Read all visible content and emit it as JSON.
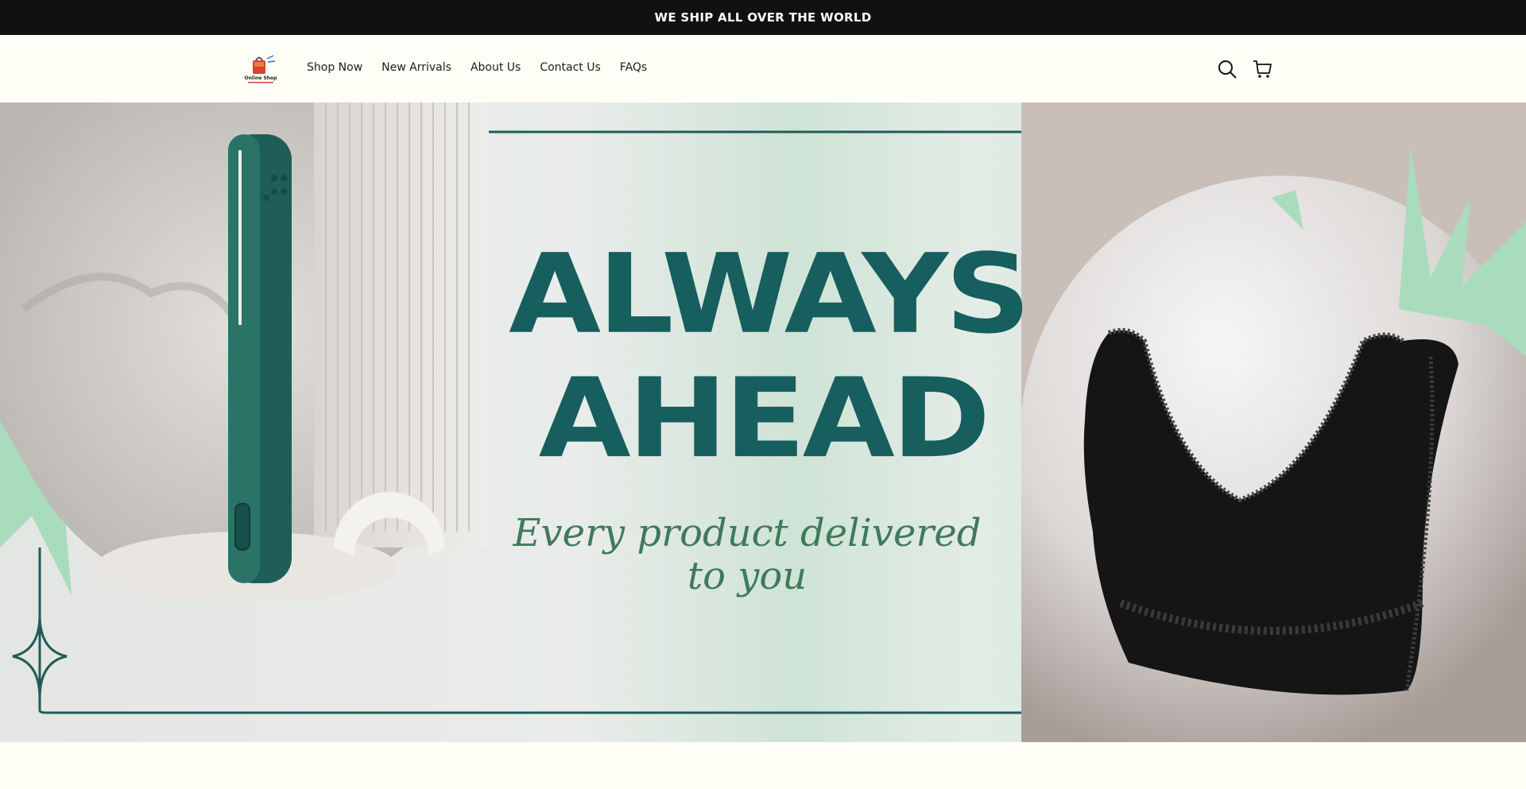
{
  "announcement": {
    "text": "WE SHIP ALL OVER THE WORLD"
  },
  "header": {
    "logo": {
      "text": "Online Shop",
      "icon": "shopping-bag-logo"
    },
    "nav": [
      {
        "label": "Shop Now"
      },
      {
        "label": "New Arrivals"
      },
      {
        "label": "About Us"
      },
      {
        "label": "Contact Us"
      },
      {
        "label": "FAQs"
      }
    ],
    "icons": {
      "search": "search-icon",
      "cart": "cart-icon"
    }
  },
  "hero": {
    "headline_line1": "ALWAYS",
    "headline_line2": "AHEAD",
    "tagline_line1": "Every product delivered",
    "tagline_line2": "to you",
    "colors": {
      "headline": "#175e5e",
      "tagline": "#3f7a5a",
      "accent_green": "#a8dcbc",
      "frame": "#1f5c58"
    },
    "images": {
      "left_product": "hair-straightener-image",
      "right_product": "black-lace-bra-image"
    }
  }
}
